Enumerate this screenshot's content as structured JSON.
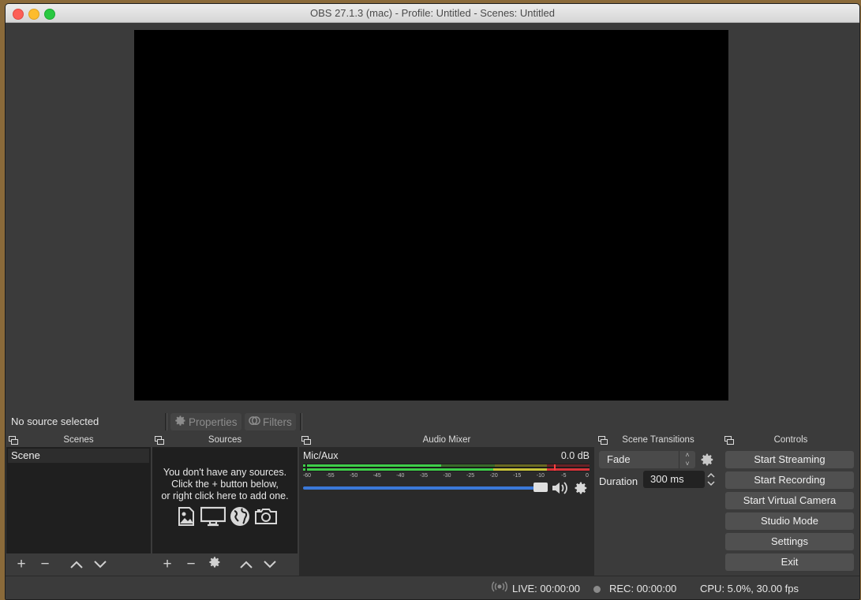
{
  "window": {
    "title": "OBS 27.1.3 (mac) - Profile: Untitled - Scenes: Untitled"
  },
  "context_bar": {
    "status": "No source selected",
    "properties_label": "Properties",
    "filters_label": "Filters"
  },
  "docks": {
    "scenes": {
      "title": "Scenes",
      "items": [
        "Scene"
      ]
    },
    "sources": {
      "title": "Sources",
      "empty_line1": "You don't have any sources.",
      "empty_line2": "Click the + button below,",
      "empty_line3": "or right click here to add one."
    },
    "audio_mixer": {
      "title": "Audio Mixer",
      "channel": "Mic/Aux",
      "level": "0.0 dB",
      "scale": [
        "-60",
        "-55",
        "-50",
        "-45",
        "-40",
        "-35",
        "-30",
        "-25",
        "-20",
        "-15",
        "-10",
        "-5",
        "0"
      ],
      "volume_fraction": 1.0
    },
    "scene_transitions": {
      "title": "Scene Transitions",
      "transition": "Fade",
      "duration_label": "Duration",
      "duration_value": "300 ms"
    },
    "controls": {
      "title": "Controls",
      "buttons": [
        "Start Streaming",
        "Start Recording",
        "Start Virtual Camera",
        "Studio Mode",
        "Settings",
        "Exit"
      ]
    }
  },
  "status_bar": {
    "live": "LIVE: 00:00:00",
    "rec": "REC: 00:00:00",
    "cpu": "CPU: 5.0%, 30.00 fps"
  },
  "colors": {
    "meter_green": "#3fcf4a",
    "meter_yellow": "#c8c43a",
    "meter_red": "#d8343a",
    "volume_blue": "#3a78d8"
  }
}
